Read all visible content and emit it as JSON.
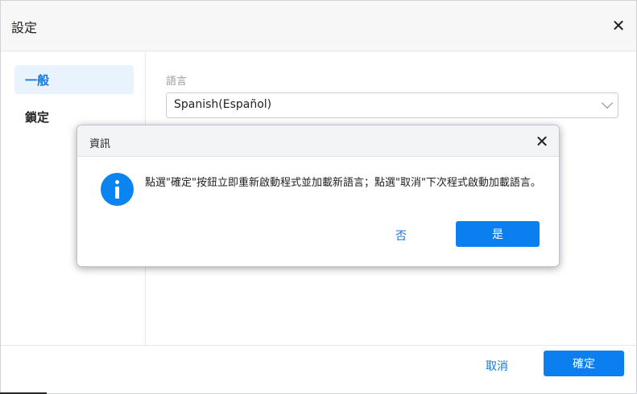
{
  "window": {
    "title": "設定",
    "close_icon": "close-icon"
  },
  "sidebar": {
    "items": [
      {
        "label": "一般",
        "active": true
      },
      {
        "label": "鎖定",
        "active": false
      }
    ]
  },
  "main": {
    "language_label": "語言",
    "language_value": "Spanish(Español)"
  },
  "footer": {
    "cancel_label": "取消",
    "confirm_label": "確定"
  },
  "dialog": {
    "title": "資訊",
    "message": "點選\"確定\"按鈕立即重新啟動程式並加載新語言；點選\"取消\"下次程式啟動加載語言。",
    "no_label": "否",
    "yes_label": "是",
    "icon": "info-icon"
  },
  "colors": {
    "accent": "#0b7ef0",
    "active_nav_bg": "#e9f3fe",
    "link": "#1677d6"
  }
}
